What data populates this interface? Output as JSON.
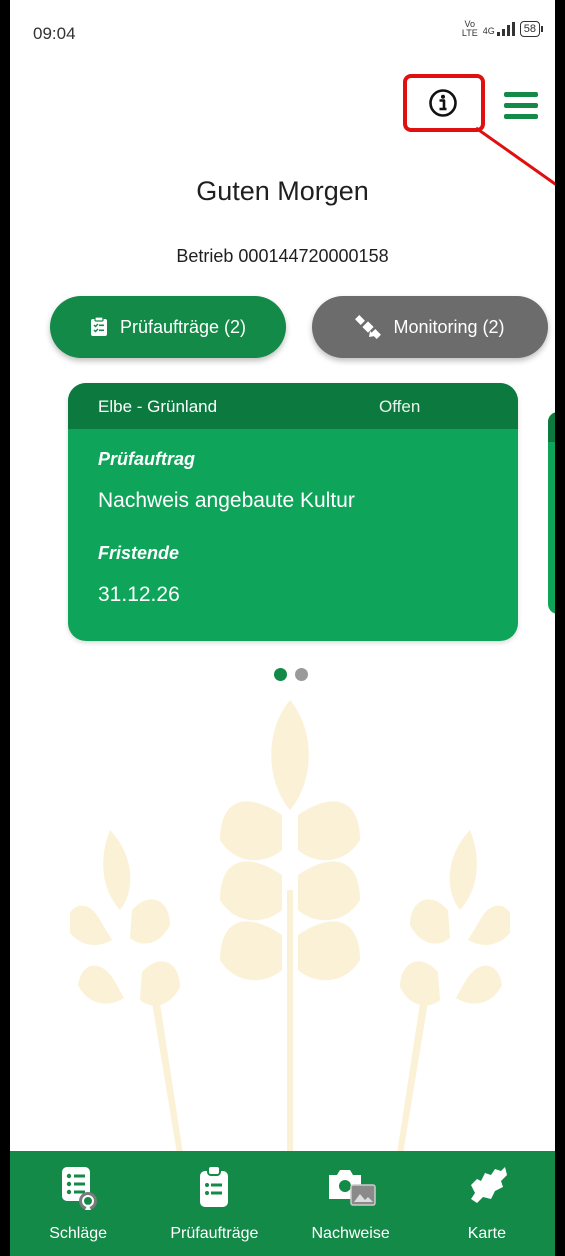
{
  "status_bar": {
    "time": "09:04",
    "volte_top": "Vo",
    "volte_bottom": "LTE",
    "network": "4G",
    "battery": "58"
  },
  "header": {
    "info_icon": "info-icon",
    "menu_icon": "hamburger-menu-icon"
  },
  "greeting": "Guten Morgen",
  "farm_label": "Betrieb 000144720000158",
  "chips": {
    "pruefauftraege": "Prüfaufträge (2)",
    "monitoring": "Monitoring (2)"
  },
  "card": {
    "location": "Elbe - Grünland",
    "status": "Offen",
    "type_label": "Prüfauftrag",
    "type_value": "Nachweis angebaute Kultur",
    "deadline_label": "Fristende",
    "deadline_value": "31.12.26"
  },
  "pager": {
    "count": 2,
    "active_index": 0
  },
  "nav": [
    {
      "label": "Schläge",
      "icon": "fields-list-icon"
    },
    {
      "label": "Prüfaufträge",
      "icon": "clipboard-icon"
    },
    {
      "label": "Nachweise",
      "icon": "camera-gallery-icon"
    },
    {
      "label": "Karte",
      "icon": "map-region-icon"
    }
  ],
  "colors": {
    "primary": "#138a48",
    "card": "#0ea55a",
    "card_header": "#0c7a3f",
    "secondary_chip": "#6c6c6c",
    "highlight": "#e01010",
    "wheat": "#fbf1d6"
  }
}
